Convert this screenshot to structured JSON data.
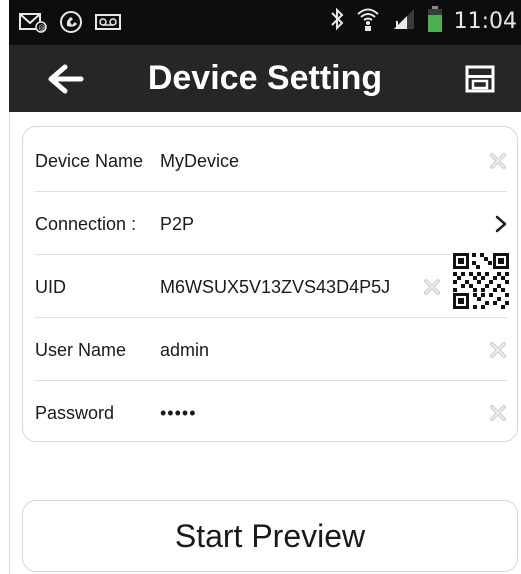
{
  "status_bar": {
    "time": "11:04",
    "icons": [
      "voicemail-icon",
      "missed-call-icon",
      "tape-icon",
      "bluetooth-icon",
      "wifi-icon",
      "signal-icon",
      "battery-icon"
    ]
  },
  "app_bar": {
    "title": "Device Setting",
    "back_icon": "back-arrow-icon",
    "save_icon": "save-icon"
  },
  "form": {
    "device_name": {
      "label": "Device Name",
      "value": "MyDevice"
    },
    "connection": {
      "label": "Connection",
      "separator": ":",
      "value": "P2P"
    },
    "uid": {
      "label": "UID",
      "value": "M6WSUX5V13ZVS43D4P5J"
    },
    "user_name": {
      "label": "User Name",
      "value": "admin"
    },
    "password": {
      "label": "Password",
      "value": "•••••"
    }
  },
  "start_button": {
    "label": "Start Preview"
  },
  "colors": {
    "status_bar": "#0d0d0d",
    "app_bar": "#262626",
    "battery": "#4caf50",
    "card_border": "#d6d6d6"
  }
}
